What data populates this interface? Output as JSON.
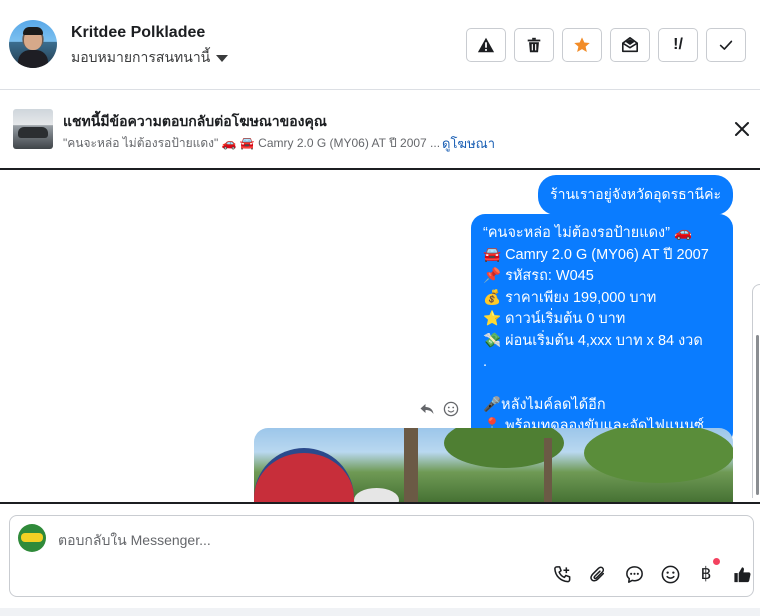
{
  "header": {
    "user_name": "Kritdee Polkladee",
    "assign_label": "มอบหมายการสนทนานี้",
    "actions": [
      {
        "icon": "warning-icon"
      },
      {
        "icon": "trash-icon"
      },
      {
        "icon": "star-icon",
        "color": "#f28c28"
      },
      {
        "icon": "open-envelope-icon"
      },
      {
        "icon": "follow-up-icon",
        "label": "!/"
      },
      {
        "icon": "check-icon"
      }
    ]
  },
  "ad": {
    "title": "แชทนี้มีข้อความตอบกลับต่อโฆษณาของคุณ",
    "subtitle": "\"คนจะหล่อ ไม่ต้องรอป้ายแดง\" 🚗 🚘 Camry 2.0 G (MY06) AT ปี 2007 ...",
    "link": "ดูโฆษณา"
  },
  "messages": {
    "msg1": "ร้านเราอยู่จังหวัดอุดรธานีค่ะ",
    "msg2_lines": [
      "“คนจะหล่อ ไม่ต้องรอป้ายแดง” 🚗",
      "🚘 Camry 2.0 G (MY06) AT ปี 2007",
      "📌 รหัสรถ: W045",
      "💰 ราคาเพียง 199,000 บาท",
      "⭐ ดาวน์เริ่มต้น 0 บาท",
      "💸 ผ่อนเริ่มต้น 4,xxx บาท x 84 งวด",
      ".",
      "",
      "🎤หลังไมค์ลดได้อีก",
      "📍 พร้อมทดลองขับและจัดไฟแนนซ์"
    ]
  },
  "composer": {
    "placeholder": "ตอบกลับใน Messenger...",
    "currency_symbol": "฿"
  },
  "colors": {
    "bubble": "#0a7cff",
    "link": "#1a5fb4",
    "notification_dot": "#f3425f"
  }
}
